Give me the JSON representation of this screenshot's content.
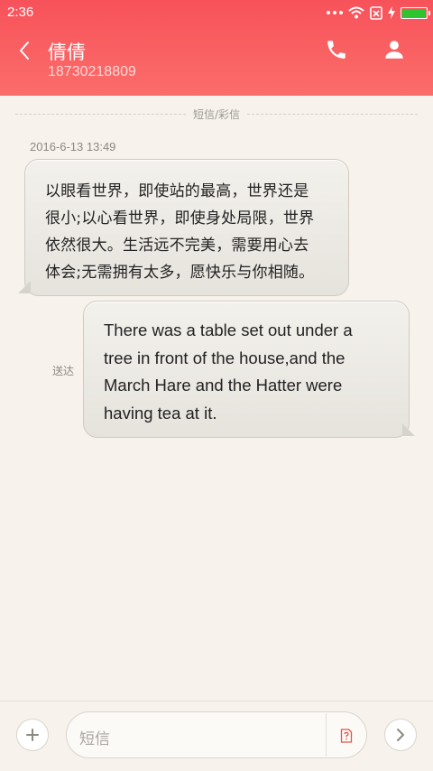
{
  "status_bar": {
    "time": "2:36"
  },
  "header": {
    "contact_name": "倩倩",
    "contact_number": "18730218809"
  },
  "thread": {
    "divider_label": "短信/彩信",
    "timestamp": "2016-6-13 13:49",
    "incoming_lines": [
      "以眼看世界，即使站的最高，世界还是",
      "很小;以心看世界，即使身处局限，世界",
      "依然很大。生活远不完美，需要用心去",
      "体会;无需拥有太多，愿快乐与你相随。"
    ],
    "outgoing_lines": [
      "There was a table set out under a",
      "tree in front of the house,and the",
      "March Hare and the Hatter were",
      "having tea at it."
    ],
    "outgoing_status": "送达"
  },
  "composer": {
    "placeholder": "短信"
  },
  "colors": {
    "header_accent": "#f7525a",
    "background": "#f7f3ec",
    "battery": "#2fc32d",
    "sim_icon": "#e2554c"
  },
  "icons": {
    "back": "back-arrow-icon",
    "call": "phone-icon",
    "contact": "person-icon",
    "attach": "plus-icon",
    "sim": "sim-card-icon",
    "send": "chevron-right-icon"
  }
}
